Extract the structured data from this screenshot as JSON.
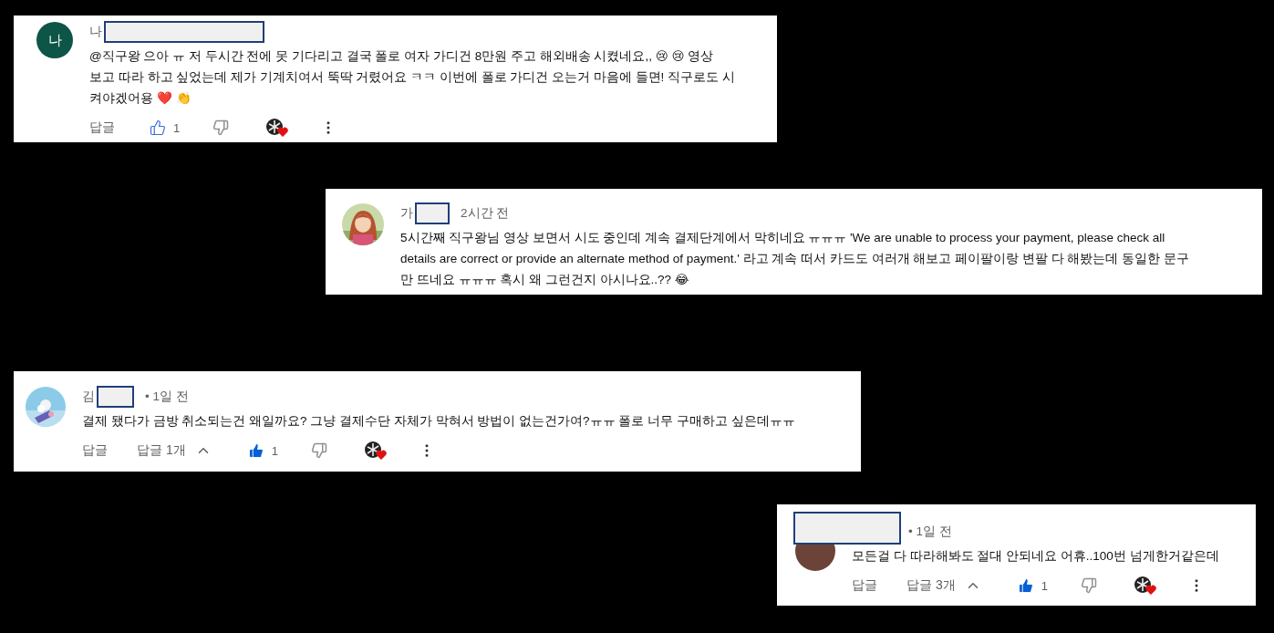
{
  "comments": [
    {
      "avatar": {
        "kind": "letter",
        "letter": "나",
        "color": "#0d5546"
      },
      "author": "나",
      "avatar_redacted": false,
      "lines": [
        "@직구왕  으아 ㅠ 저 두시간 전에 못 기다리고 결국 폴로 여자 가디건 8만원 주고 해외배송 시켰네요,, 😢 😢  영상",
        "보고 따라 하고 싶었는데 제가 기계치여서 뚝딱 거렸어요 ㅋㅋ 이번에 폴로 가디건 오는거 마음에 들면! 직구로도 시",
        "켜야겠어용 ❤️ 👏"
      ],
      "reply": "답글",
      "liked": false,
      "likes": "1",
      "hearted": true
    },
    {
      "avatar": {
        "kind": "picture"
      },
      "author": "가",
      "avatar_redacted": false,
      "time": "2시간 전",
      "lines": [
        "5시간째 직구왕님 영상 보면서 시도 중인데 계속 결제단계에서 막히네요 ㅠㅠㅠ 'We are unable to process your payment, please check all",
        "details are correct or provide an alternate method of payment.' 라고 계속 떠서 카드도 여러개 해보고 페이팔이랑 변팔 다 해봤는데 동일한 문구",
        "만 뜨네요 ㅠㅠㅠ 혹시 왜 그런건지 아시나요..?? 😂"
      ]
    },
    {
      "avatar": {
        "kind": "picture"
      },
      "author": "김",
      "avatar_redacted": false,
      "time": "• 1일 전",
      "lines": [
        "결제 됐다가 금방 취소되는건 왜일까요? 그냥 결제수단 자체가 막혀서 방법이 없는건가여?ㅠㅠ 폴로 너무 구매하고 싶은데ㅠㅠ"
      ],
      "reply": "답글",
      "replies": "답글 1개",
      "liked": true,
      "likes": "1",
      "hearted": true
    },
    {
      "avatar": {
        "kind": "plain",
        "color": "#6b4338"
      },
      "avatar_redacted": true,
      "time": "• 1일 전",
      "lines": [
        "모든걸 다 따라해봐도 절대 안되네요 어휴..100번 넘게한거같은데"
      ],
      "reply": "답글",
      "replies": "답글 3개",
      "liked": true,
      "likes": "1",
      "hearted": true
    }
  ]
}
